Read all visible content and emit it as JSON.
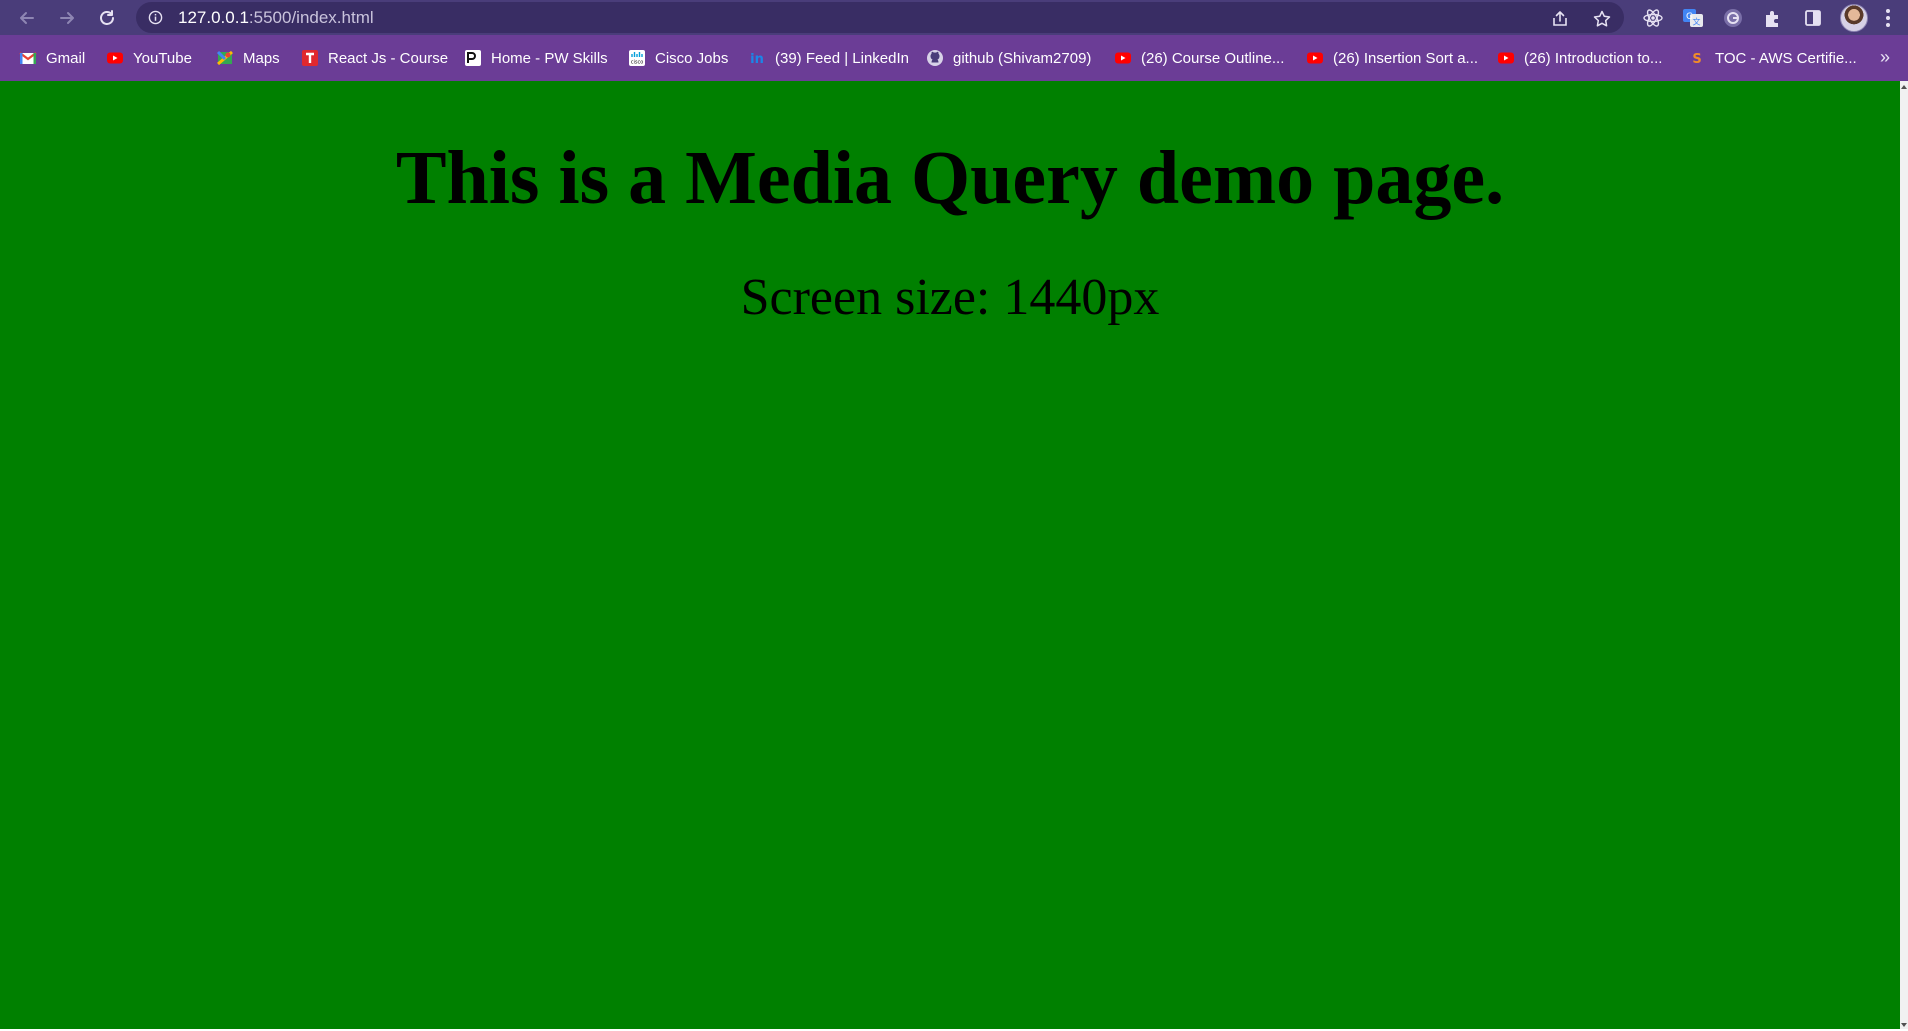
{
  "browser": {
    "url_host": "127.0.0.1",
    "url_path": ":5500/index.html",
    "colors": {
      "toolbar": "#4a3d7a",
      "bookmarks_bar": "#6b3d96",
      "omnibox": "#392d64"
    },
    "icons": [
      "back-arrow-icon",
      "forward-arrow-icon",
      "reload-icon",
      "info-icon",
      "share-icon",
      "star-icon",
      "react-devtools-icon",
      "google-translate-icon",
      "grammarly-icon",
      "extensions-puzzle-icon",
      "side-panel-icon",
      "profile-avatar",
      "more-menu-icon"
    ]
  },
  "bookmarks": [
    {
      "label": "Gmail",
      "icon": "gmail-icon"
    },
    {
      "label": "YouTube",
      "icon": "youtube-icon"
    },
    {
      "label": "Maps",
      "icon": "maps-icon"
    },
    {
      "label": "React Js - Course",
      "icon": "t-logo-icon"
    },
    {
      "label": "Home - PW Skills",
      "icon": "pw-skills-icon"
    },
    {
      "label": "Cisco Jobs",
      "icon": "cisco-icon"
    },
    {
      "label": "(39) Feed | LinkedIn",
      "icon": "linkedin-icon"
    },
    {
      "label": "github (Shivam2709)",
      "icon": "github-icon"
    },
    {
      "label": "(26) Course Outline...",
      "icon": "youtube-icon"
    },
    {
      "label": "(26) Insertion Sort a...",
      "icon": "youtube-icon"
    },
    {
      "label": "(26) Introduction to...",
      "icon": "youtube-icon"
    },
    {
      "label": "TOC - AWS Certifie...",
      "icon": "s-logo-icon"
    }
  ],
  "bookmarks_overflow": "»",
  "page": {
    "heading": "This is a Media Query demo page.",
    "screen_size_text": "Screen size: 1440px",
    "background_color": "#008000",
    "text_color": "#000000"
  }
}
